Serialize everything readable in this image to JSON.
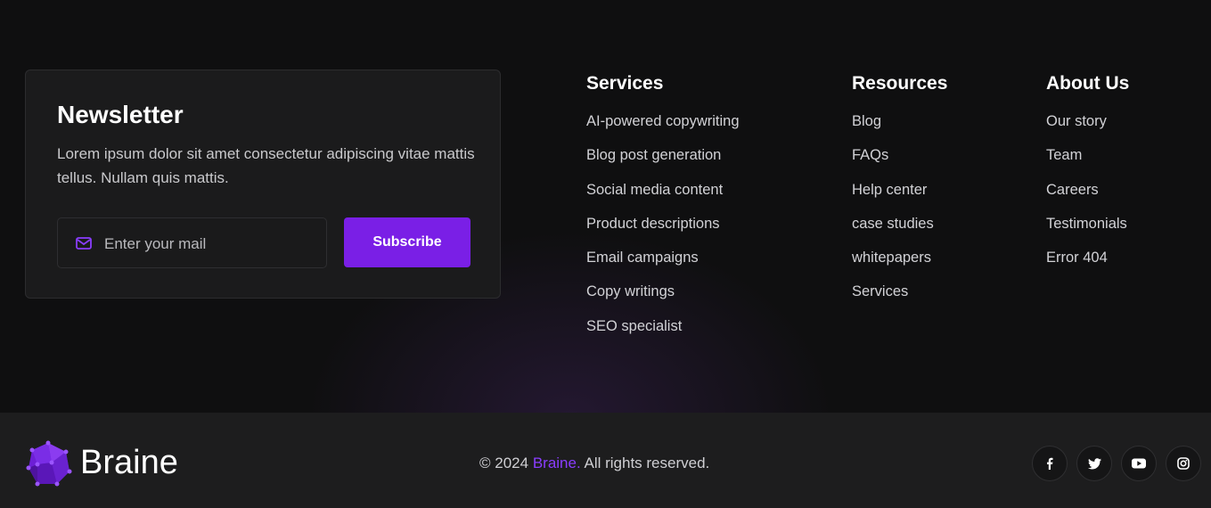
{
  "newsletter": {
    "title": "Newsletter",
    "text": "Lorem ipsum dolor sit amet consectetur adipiscing vitae mattis tellus. Nullam quis mattis.",
    "placeholder": "Enter your mail",
    "button": "Subscribe",
    "icon": "mail-icon"
  },
  "columns": [
    {
      "title": "Services",
      "items": [
        "AI-powered copywriting",
        "Blog post generation",
        "Social media content",
        "Product descriptions",
        "Email campaigns",
        "Copy writings",
        "SEO specialist"
      ]
    },
    {
      "title": "Resources",
      "items": [
        "Blog",
        "FAQs",
        "Help center",
        "case studies",
        "whitepapers",
        "Services"
      ]
    },
    {
      "title": "About Us",
      "items": [
        "Our story",
        "Team",
        "Careers",
        "Testimonials",
        "Error 404"
      ]
    }
  ],
  "footer": {
    "brand": "Braine",
    "copyright_prefix": "© 2024",
    "copyright_brand": "Braine.",
    "copyright_suffix": "All rights reserved.",
    "social": [
      "facebook-icon",
      "twitter-icon",
      "youtube-icon",
      "instagram-icon"
    ]
  },
  "colors": {
    "accent": "#7a1fe6",
    "background": "#0f0f10",
    "card": "#1b1b1c"
  }
}
